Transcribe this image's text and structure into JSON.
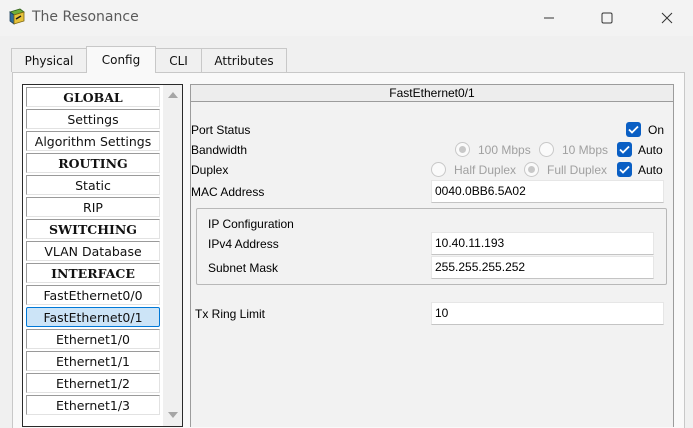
{
  "window": {
    "title": "The Resonance",
    "icon": "packet-tracer-router-icon",
    "controls": [
      "minimize-icon",
      "maximize-icon",
      "close-icon"
    ]
  },
  "tabs": [
    {
      "label": "Physical",
      "active": false
    },
    {
      "label": "Config",
      "active": true
    },
    {
      "label": "CLI",
      "active": false
    },
    {
      "label": "Attributes",
      "active": false
    }
  ],
  "sidebar": {
    "items": [
      {
        "label": "GLOBAL",
        "header": true
      },
      {
        "label": "Settings",
        "header": false
      },
      {
        "label": "Algorithm Settings",
        "header": false
      },
      {
        "label": "ROUTING",
        "header": true
      },
      {
        "label": "Static",
        "header": false
      },
      {
        "label": "RIP",
        "header": false
      },
      {
        "label": "SWITCHING",
        "header": true
      },
      {
        "label": "VLAN Database",
        "header": false
      },
      {
        "label": "INTERFACE",
        "header": true
      },
      {
        "label": "FastEthernet0/0",
        "header": false
      },
      {
        "label": "FastEthernet0/1",
        "header": false,
        "selected": true
      },
      {
        "label": "Ethernet1/0",
        "header": false
      },
      {
        "label": "Ethernet1/1",
        "header": false
      },
      {
        "label": "Ethernet1/2",
        "header": false
      },
      {
        "label": "Ethernet1/3",
        "header": false
      }
    ]
  },
  "panel": {
    "title": "FastEthernet0/1",
    "port_status": {
      "label": "Port Status",
      "on_label": "On",
      "on_checked": true
    },
    "bandwidth": {
      "label": "Bandwidth",
      "opt1": "100 Mbps",
      "opt2": "10 Mbps",
      "auto_label": "Auto",
      "auto_checked": true,
      "selected": "100 Mbps"
    },
    "duplex": {
      "label": "Duplex",
      "opt1": "Half Duplex",
      "opt2": "Full Duplex",
      "auto_label": "Auto",
      "auto_checked": true,
      "selected": "Full Duplex"
    },
    "mac": {
      "label": "MAC Address",
      "value": "0040.0BB6.5A02"
    },
    "ip_config": {
      "title": "IP Configuration",
      "ipv4_label": "IPv4 Address",
      "ipv4_value": "10.40.11.193",
      "mask_label": "Subnet Mask",
      "mask_value": "255.255.255.252"
    },
    "tx_ring": {
      "label": "Tx Ring Limit",
      "value": "10"
    }
  },
  "colors": {
    "checkbox": "#0a5fc4",
    "selection_bg": "#cce4f7",
    "selection_border": "#0078d7"
  }
}
